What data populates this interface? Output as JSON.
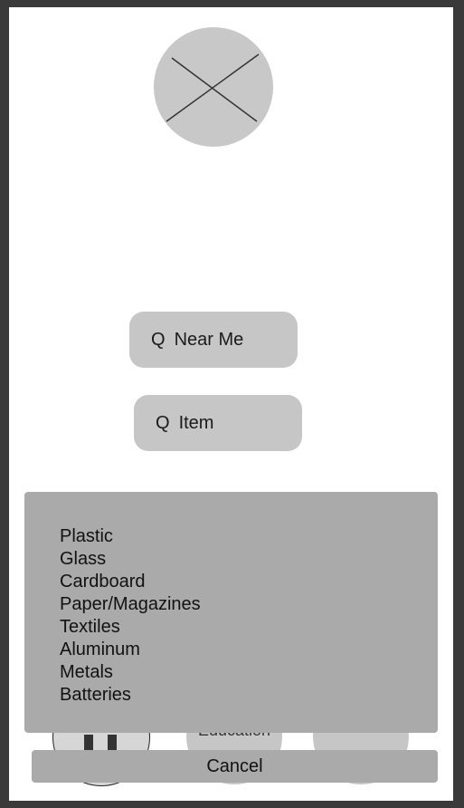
{
  "logo": {
    "icon": "placeholder-x-icon"
  },
  "search": {
    "near_me": {
      "icon": "Q",
      "label": "Near Me"
    },
    "item": {
      "icon": "Q",
      "label": "Item"
    }
  },
  "background": {
    "categories": [
      {
        "label": ""
      },
      {
        "label": "Education"
      },
      {
        "label": ""
      }
    ]
  },
  "action_sheet": {
    "options": [
      "Plastic",
      "Glass",
      "Cardboard",
      "Paper/Magazines",
      "Textiles",
      "Aluminum",
      "Metals",
      "Batteries"
    ],
    "cancel_label": "Cancel"
  },
  "colors": {
    "sheet": "#aaaaaa",
    "pill": "#c6c6c6",
    "frame_border": "#3a3a3a"
  }
}
